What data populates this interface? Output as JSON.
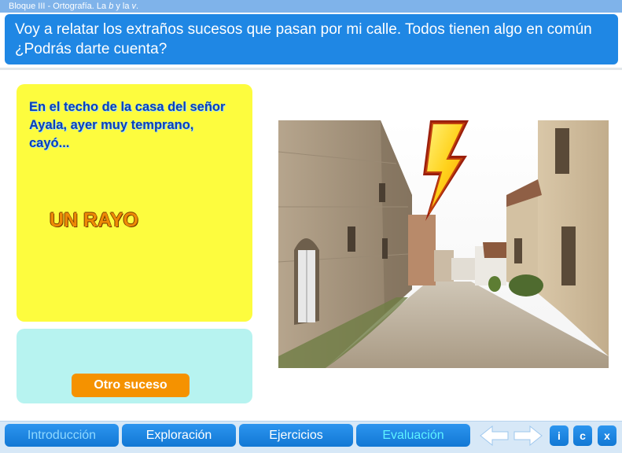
{
  "header": {
    "breadcrumb_part1": "Bloque III  -  Ortografía. La ",
    "breadcrumb_b": "b",
    "breadcrumb_part2": " y la ",
    "breadcrumb_v": "v",
    "breadcrumb_part3": "."
  },
  "question": "Voy a relatar los extraños sucesos que pasan por mi calle. Todos tienen algo en común ¿Podrás darte cuenta?",
  "card": {
    "prompt": "En el techo de la casa del señor Ayala, ayer muy temprano, cayó...",
    "answer": "UN RAYO"
  },
  "next_button": "Otro suceso",
  "nav": {
    "tabs": [
      {
        "label": "Introducción"
      },
      {
        "label": "Exploración"
      },
      {
        "label": "Ejercicios"
      },
      {
        "label": "Evaluación"
      }
    ],
    "info": "i",
    "credits": "c",
    "exit": "x"
  },
  "icons": {
    "photo": "street-photo-with-lightning-icon",
    "prev": "arrow-left-icon",
    "next": "arrow-right-icon"
  },
  "colors": {
    "accent_blue": "#1f87e4",
    "card_yellow": "#fdfc3e",
    "card_cyan": "#b7f3f0",
    "button_orange": "#f59200",
    "answer_orange": "#ee8a06",
    "prompt_blue": "#0c3fb3"
  }
}
